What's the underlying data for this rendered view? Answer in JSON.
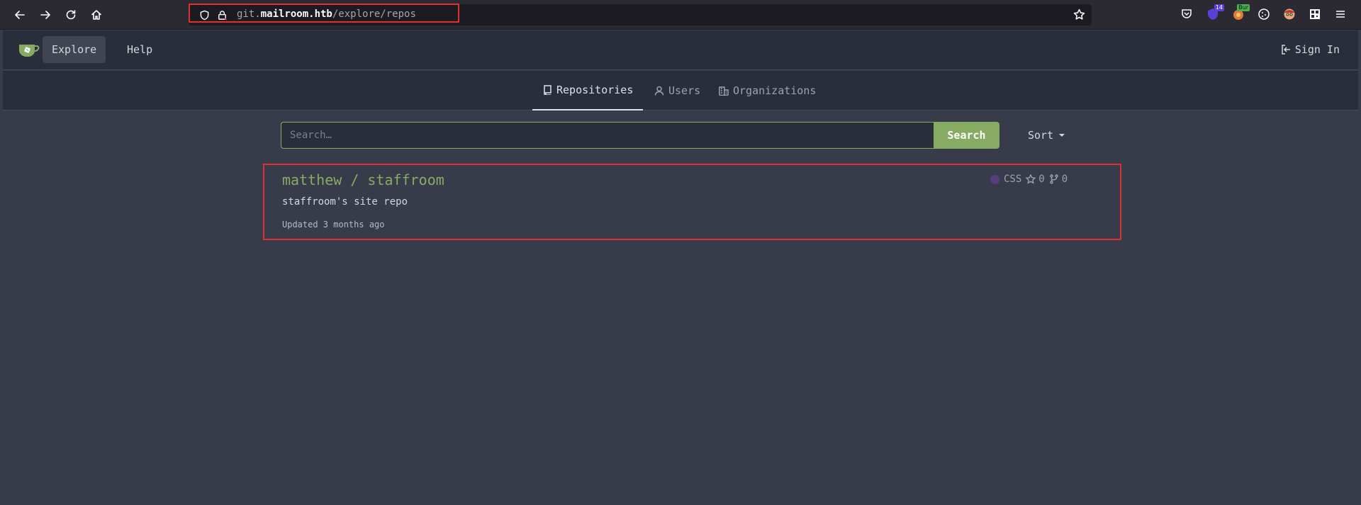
{
  "browser": {
    "url_prefix": "git.",
    "url_host": "mailroom.htb",
    "url_path": "/explore/repos",
    "extensions": [
      {
        "name": "pocket-icon"
      },
      {
        "name": "extension-shield-icon",
        "badge": "14"
      },
      {
        "name": "burp-icon",
        "badge": "Bur"
      },
      {
        "name": "cookie-icon"
      },
      {
        "name": "face-icon"
      },
      {
        "name": "qr-icon"
      }
    ]
  },
  "header": {
    "nav": [
      {
        "label": "Explore",
        "active": true
      },
      {
        "label": "Help",
        "active": false
      }
    ],
    "sign_in": "Sign In"
  },
  "tabs": [
    {
      "label": "Repositories",
      "icon": "repo-icon",
      "active": true
    },
    {
      "label": "Users",
      "icon": "user-icon",
      "active": false
    },
    {
      "label": "Organizations",
      "icon": "organization-icon",
      "active": false
    }
  ],
  "search": {
    "placeholder": "Search…",
    "value": "",
    "button_label": "Search",
    "sort_label": "Sort"
  },
  "repos": [
    {
      "title": "matthew / staffroom",
      "description": "staffroom's site repo",
      "updated": "Updated 3 months ago",
      "language": "CSS",
      "language_color": "#563d7c",
      "stars": "0",
      "forks": "0"
    }
  ],
  "colors": {
    "accent": "#87ab63",
    "highlight": "#e03131",
    "page_bg": "#383c4a",
    "header_bg": "#2a2e3a"
  }
}
